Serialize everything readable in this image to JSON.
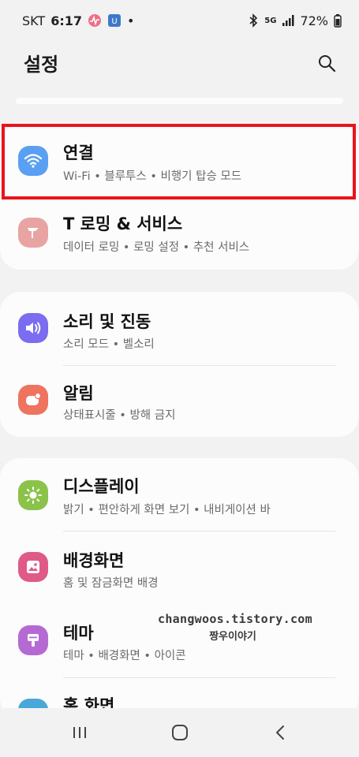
{
  "status_bar": {
    "carrier": "SKT",
    "time": "6:17",
    "dot": "•",
    "network": "5G",
    "battery": "72%",
    "icons": [
      "app-notification-icon",
      "sim-icon",
      "bluetooth-icon",
      "signal-icon",
      "battery-icon"
    ]
  },
  "header": {
    "title": "설정",
    "search_icon": "search-icon"
  },
  "settings": {
    "connections": {
      "title": "연결",
      "subtitle": "Wi-Fi  •  블루투스  •  비행기 탑승 모드",
      "icon": "wifi-icon",
      "color": "#5aa0f2"
    },
    "troaming": {
      "title": "T 로밍 & 서비스",
      "subtitle": "데이터 로밍  •  로밍 설정  •  추천 서비스",
      "icon": "t-roaming-icon",
      "color": "#e8a3a3"
    },
    "sound": {
      "title": "소리 및 진동",
      "subtitle": "소리 모드  •  벨소리",
      "icon": "speaker-icon",
      "color": "#7a6df0"
    },
    "notifications": {
      "title": "알림",
      "subtitle": "상태표시줄  •  방해 금지",
      "icon": "notification-icon",
      "color": "#ee7460"
    },
    "display": {
      "title": "디스플레이",
      "subtitle": "밝기  •  편안하게 화면 보기  •  내비게이션 바",
      "icon": "sun-icon",
      "color": "#8bc34a"
    },
    "wallpaper": {
      "title": "배경화면",
      "subtitle": "홈 및 잠금화면 배경",
      "icon": "image-icon",
      "color": "#e05a86"
    },
    "themes": {
      "title": "테마",
      "subtitle": "테마  •  배경화면  •  아이콘",
      "icon": "brush-icon",
      "color": "#b56ad3"
    },
    "home_screen": {
      "title": "홈 화면",
      "icon": "home-screen-icon",
      "color": "#4aa8d8"
    }
  },
  "watermark": {
    "line1": "changwoos.tistory.com",
    "line2": "짱우이야기"
  },
  "nav_bar": {
    "recents": "recents-icon",
    "home": "home-icon",
    "back": "back-icon"
  }
}
